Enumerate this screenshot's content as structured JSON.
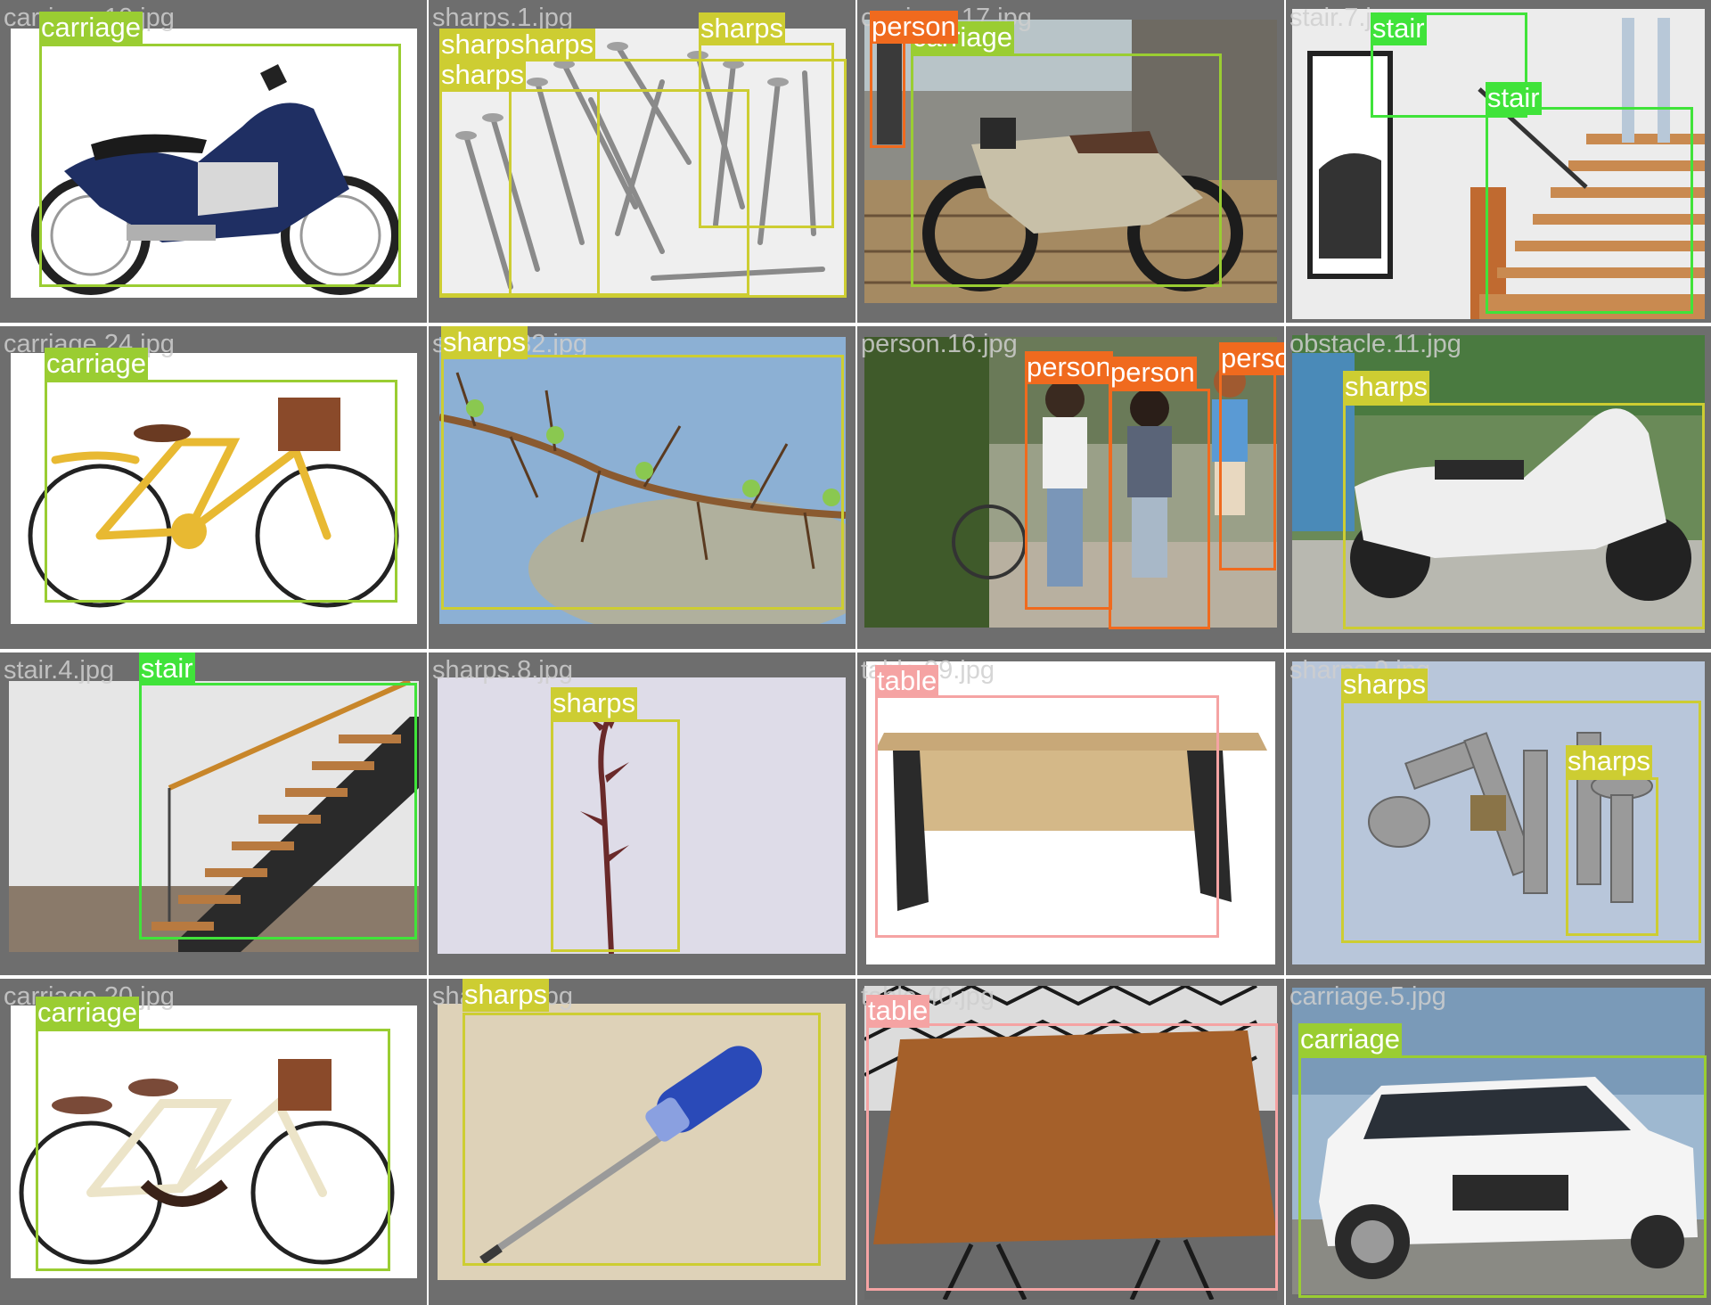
{
  "colors": {
    "carriage": "#9acd32",
    "sharps": "#cdcd32",
    "person": "#f06a1e",
    "stair": "#40e33a",
    "table": "#f5a3a3",
    "grid_bg": "#6e6e6e"
  },
  "tiles": [
    {
      "filename": "carriage.10.jpg",
      "subject": "motorcycle-icon",
      "detections": [
        {
          "label": "carriage",
          "class": "carriage"
        }
      ]
    },
    {
      "filename": "sharps.1.jpg",
      "subject": "nails-icon",
      "detections": [
        {
          "label": "sharps",
          "class": "sharps"
        },
        {
          "label": "sharps",
          "class": "sharps"
        },
        {
          "label": "sharps",
          "class": "sharps"
        },
        {
          "label": "sharps",
          "class": "sharps"
        }
      ]
    },
    {
      "filename": "carriage.17.jpg",
      "subject": "motorcycle-icon",
      "detections": [
        {
          "label": "carriage",
          "class": "carriage"
        },
        {
          "label": "person",
          "class": "person"
        }
      ]
    },
    {
      "filename": "stair.7.jpg",
      "subject": "staircase-icon",
      "detections": [
        {
          "label": "stair",
          "class": "stair"
        },
        {
          "label": "stair",
          "class": "stair"
        }
      ]
    },
    {
      "filename": "carriage.24.jpg",
      "subject": "bicycle-icon",
      "detections": [
        {
          "label": "carriage",
          "class": "carriage"
        }
      ]
    },
    {
      "filename": "sharps.32.jpg",
      "subject": "thorny-branch-icon",
      "detections": [
        {
          "label": "sharps",
          "class": "sharps"
        }
      ]
    },
    {
      "filename": "person.16.jpg",
      "subject": "pedestrians-icon",
      "detections": [
        {
          "label": "person",
          "class": "person"
        },
        {
          "label": "person",
          "class": "person"
        },
        {
          "label": "person",
          "class": "person"
        }
      ]
    },
    {
      "filename": "obstacle.11.jpg",
      "subject": "scooter-icon",
      "detections": [
        {
          "label": "sharps",
          "class": "sharps"
        }
      ]
    },
    {
      "filename": "stair.4.jpg",
      "subject": "staircase-icon",
      "detections": [
        {
          "label": "stair",
          "class": "stair"
        }
      ]
    },
    {
      "filename": "sharps.8.jpg",
      "subject": "thorn-stem-icon",
      "detections": [
        {
          "label": "sharps",
          "class": "sharps"
        }
      ]
    },
    {
      "filename": "table.39.jpg",
      "subject": "desk-icon",
      "detections": [
        {
          "label": "table",
          "class": "table"
        }
      ]
    },
    {
      "filename": "sharps.9.jpg",
      "subject": "screws-icon",
      "detections": [
        {
          "label": "sharps",
          "class": "sharps"
        },
        {
          "label": "sharps",
          "class": "sharps"
        }
      ]
    },
    {
      "filename": "carriage.20.jpg",
      "subject": "bicycle-icon",
      "detections": [
        {
          "label": "carriage",
          "class": "carriage"
        }
      ]
    },
    {
      "filename": "sharps.7.jpg",
      "subject": "screwdriver-icon",
      "detections": [
        {
          "label": "sharps",
          "class": "sharps"
        }
      ]
    },
    {
      "filename": "table.40.jpg",
      "subject": "table-icon",
      "detections": [
        {
          "label": "table",
          "class": "table"
        }
      ]
    },
    {
      "filename": "carriage.5.jpg",
      "subject": "suv-car-icon",
      "detections": [
        {
          "label": "carriage",
          "class": "carriage"
        }
      ]
    }
  ]
}
